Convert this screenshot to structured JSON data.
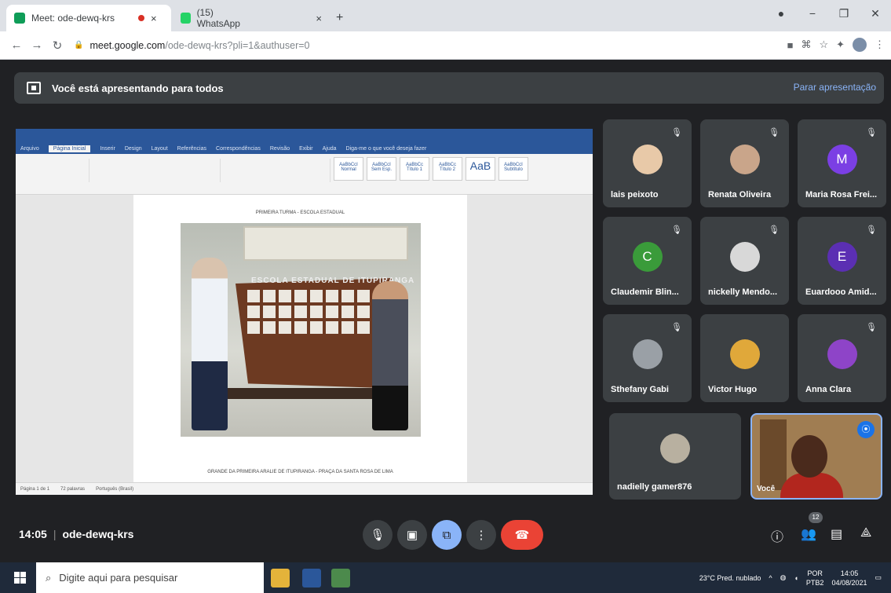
{
  "browser": {
    "tabs": [
      {
        "title": "Meet: ode-dewq-krs",
        "color": "#0f9d58"
      },
      {
        "title": "(15) WhatsApp",
        "color": "#25d366"
      }
    ],
    "url_host": "meet.google.com",
    "url_path": "/ode-dewq-krs?pli=1&authuser=0"
  },
  "meet": {
    "banner_text": "Você está apresentando para todos",
    "stop_label": "Parar apresentação",
    "time": "14:05",
    "code": "ode-dewq-krs",
    "participants_count": "12"
  },
  "document": {
    "title": "PRIMEIRA TURMA - ESCOLA ESTADUAL",
    "board_label": "ESCOLA ESTADUAL DE ITUPIRANGA",
    "caption": "GRANDE DA PRIMEIRA ARALIE DE ITUPIRANGA - PRAÇA DA SANTA ROSA DE LIMA",
    "styles": [
      "AaBbCcI",
      "AaBbCcI",
      "AaBbCc",
      "AaBbCc",
      "AaB",
      "AaBbCcI"
    ],
    "style_names": [
      "Normal",
      "Sem Esp.",
      "Título 1",
      "Título 2",
      "Título",
      "Subtítulo"
    ],
    "menu": [
      "Arquivo",
      "Página Inicial",
      "Inserir",
      "Design",
      "Layout",
      "Referências",
      "Correspondências",
      "Revisão",
      "Exibir",
      "Ajuda",
      "Diga-me o que você deseja fazer"
    ],
    "status": [
      "Página 1 de 1",
      "72 palavras",
      "Português (Brasil)"
    ]
  },
  "participants": [
    {
      "name": "lais peixoto",
      "avatar": "photo",
      "color": "#e8c9a8"
    },
    {
      "name": "Renata Oliveira",
      "avatar": "photo",
      "color": "#c9a58a"
    },
    {
      "name": "Maria Rosa Frei...",
      "avatar": "M",
      "color": "#7b3fe4"
    },
    {
      "name": "Claudemir Blin...",
      "avatar": "C",
      "color": "#3a9b3a"
    },
    {
      "name": "nickelly Mendo...",
      "avatar": "photo",
      "color": "#d8d8d8"
    },
    {
      "name": "Euardooo Amid...",
      "avatar": "E",
      "color": "#5b2fb3"
    },
    {
      "name": "Sthefany Gabi",
      "avatar": "photo",
      "color": "#9aa0a6"
    },
    {
      "name": "Victor Hugo",
      "avatar": "photo",
      "color": "#e0a83a"
    },
    {
      "name": "Anna Clara",
      "avatar": "photo",
      "color": "#8e44c8"
    },
    {
      "name": "nadielly gamer876",
      "avatar": "photo",
      "color": "#b8b0a0"
    }
  ],
  "self_tile": {
    "label": "Você"
  },
  "taskbar": {
    "search_placeholder": "Digite aqui para pesquisar",
    "weather": "23°C Pred. nublado",
    "lang": "POR",
    "lang2": "PTB2",
    "clock_time": "14:05",
    "clock_date": "04/08/2021"
  }
}
